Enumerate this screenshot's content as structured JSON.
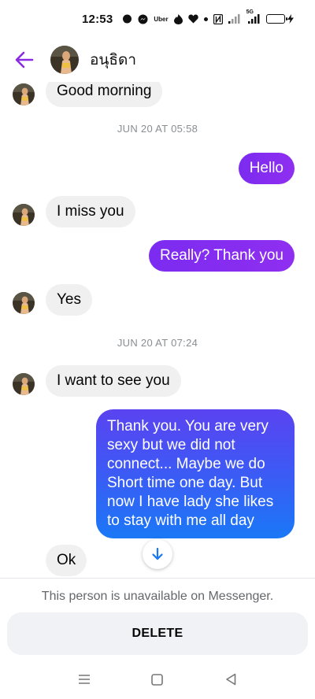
{
  "status_bar": {
    "time": "12:53",
    "icons": [
      "chat-bubble-icon",
      "messenger-icon",
      "uber-icon",
      "tinder-icon",
      "heart-icon",
      "dot-icon",
      "nfc-icon",
      "signal-icon",
      "5g-signal-icon",
      "battery-charging-icon"
    ],
    "uber_label": "Uber",
    "fiveg_label": "5G"
  },
  "header": {
    "contact_name": "อนุธิดา",
    "accent_color": "#8a2be2"
  },
  "messages": [
    {
      "direction": "in",
      "text": "Good morning"
    },
    {
      "type": "timestamp",
      "text": "JUN 20 AT 05:58"
    },
    {
      "direction": "out",
      "text": "Hello"
    },
    {
      "direction": "in",
      "text": "I miss you"
    },
    {
      "direction": "out",
      "text": "Really? Thank you"
    },
    {
      "direction": "in",
      "text": "Yes"
    },
    {
      "type": "timestamp",
      "text": "JUN 20 AT 07:24"
    },
    {
      "direction": "in",
      "text": "I want to see you"
    },
    {
      "direction": "out",
      "text": "Thank you.  You are very sexy but we did not connect... Maybe we do Short time one day.  But now I have lady she likes to stay with me all day"
    },
    {
      "direction": "in",
      "text": "Ok"
    }
  ],
  "footer": {
    "unavailable_text": "This person is unavailable on Messenger.",
    "delete_label": "DELETE"
  },
  "colors": {
    "outgoing_purple": "#8a2be2",
    "outgoing_blue": "#1a78f6",
    "incoming_gray": "#f0f0f0"
  }
}
